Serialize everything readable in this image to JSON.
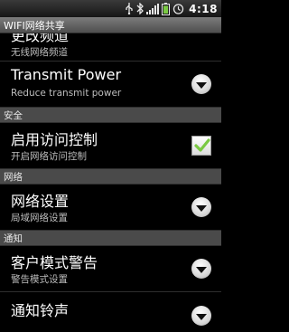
{
  "status_bar": {
    "icons": [
      "usb-icon",
      "bluetooth-icon",
      "signal-icon",
      "battery-icon",
      "alarm-icon"
    ],
    "time": "4:18"
  },
  "title_bar": {
    "title": "WIFI网络共享"
  },
  "list": {
    "partial_item": {
      "title": "更改频道",
      "summary": "无线网络频道"
    },
    "transmit_power": {
      "title": "Transmit Power",
      "summary": "Reduce transmit power"
    },
    "security_category": "安全",
    "access_control": {
      "title": "启用访问控制",
      "summary": "开启网络访问控制",
      "checked": true
    },
    "network_category": "网络",
    "network_settings": {
      "title": "网络设置",
      "summary": "局域网络设置"
    },
    "notify_category": "通知",
    "client_mode_warning": {
      "title": "客户模式警告",
      "summary": "警告模式设置"
    },
    "notify_ringtone": {
      "title": "通知铃声"
    }
  },
  "colors": {
    "checkmark": "#7ac943",
    "category_bg": "#4a4a4a"
  }
}
